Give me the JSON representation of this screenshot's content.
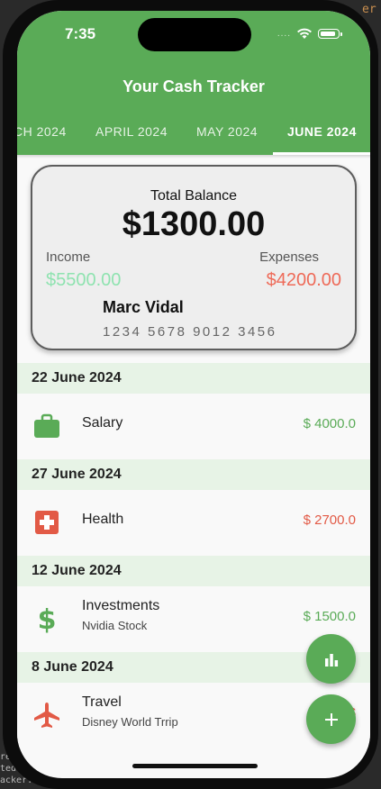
{
  "status_bar": {
    "time": "7:35",
    "signal": "....",
    "icons": [
      "wifi-icon",
      "battery-icon"
    ]
  },
  "app": {
    "title": "Your Cash Tracker"
  },
  "tabs": [
    {
      "label": "CH 2024",
      "active": false
    },
    {
      "label": "APRIL 2024",
      "active": false
    },
    {
      "label": "MAY 2024",
      "active": false
    },
    {
      "label": "JUNE 2024",
      "active": true
    }
  ],
  "card": {
    "title": "Total Balance",
    "balance": "$1300.00",
    "income_label": "Income",
    "income_value": "$5500.00",
    "expenses_label": "Expenses",
    "expenses_value": "$4200.00",
    "holder": "Marc Vidal",
    "number": "1234 5678 9012 3456"
  },
  "groups": [
    {
      "date": "22 June 2024",
      "items": [
        {
          "title": "Salary",
          "subtitle": "",
          "amount": "$ 4000.0",
          "type": "income",
          "icon": "briefcase-icon"
        }
      ]
    },
    {
      "date": "27 June 2024",
      "items": [
        {
          "title": "Health",
          "subtitle": "",
          "amount": "$ 2700.0",
          "type": "expense",
          "icon": "medical-cross-icon"
        }
      ]
    },
    {
      "date": "12 June 2024",
      "items": [
        {
          "title": "Investments",
          "subtitle": "Nvidia Stock",
          "amount": "$ 1500.0",
          "type": "income",
          "icon": "dollar-icon"
        }
      ]
    },
    {
      "date": "8 June 2024",
      "items": [
        {
          "title": "Travel",
          "subtitle": "Disney World Trrip",
          "amount": "$",
          "type": "expense",
          "icon": "airplane-icon"
        }
      ]
    }
  ],
  "fabs": {
    "stats_icon": "bar-chart-icon",
    "add_icon": "plus-icon"
  },
  "background_editor_text": [
    "er",
    "re",
    "ted",
    "acker:"
  ],
  "colors": {
    "primary": "#5aab57",
    "income": "#5aab57",
    "expense": "#e25a46",
    "card_income": "#8fe3b0",
    "card_expense": "#ee6a58"
  }
}
